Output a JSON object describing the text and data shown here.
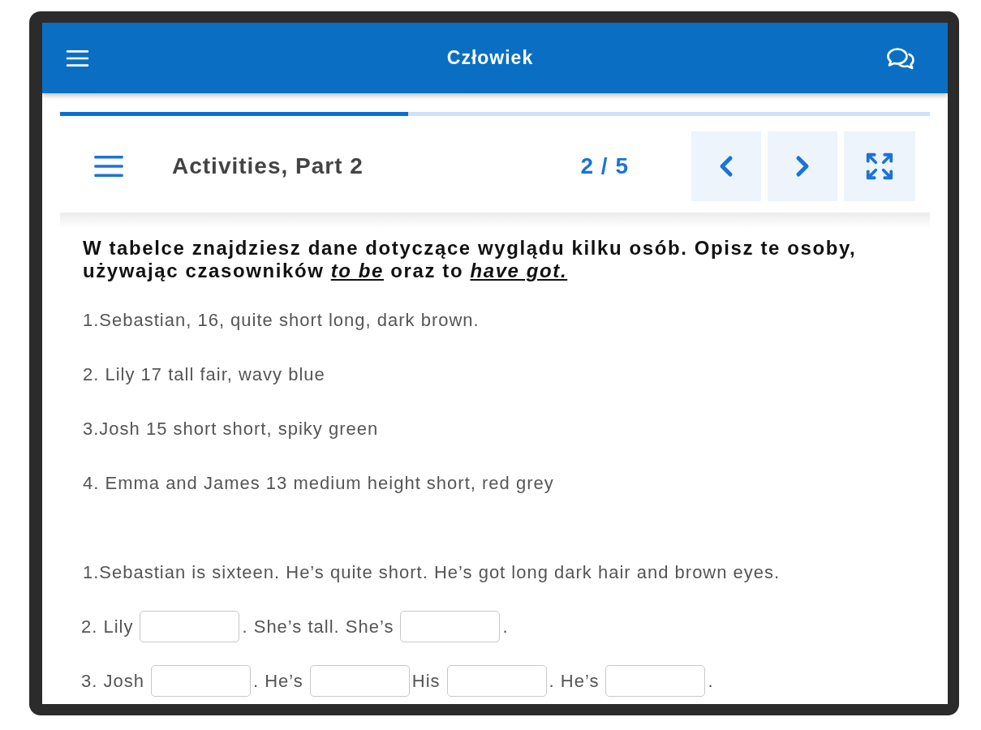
{
  "header": {
    "title": "Człowiek"
  },
  "progress": {
    "level": 0.4
  },
  "toolbar": {
    "title": "Activities, Part 2",
    "page": "2 / 5"
  },
  "task": {
    "instruction": "W tabelce znajdziesz dane dotyczące wyglądu kilku osób. Opisz te osoby, używając czasowników *to be* oraz to *have got.*",
    "data_lines": [
      "1.Sebastian, 16, quite short long, dark brown.",
      "2. Lily 17 tall fair, wavy blue",
      "3.Josh 15 short short, spiky green",
      "4. Emma and James 13 medium height short, red grey"
    ],
    "example": "1.Sebastian is sixteen. He’s quite short. He’s got long dark hair and brown eyes.",
    "rows": [
      {
        "parts": [
          {
            "kind": "text",
            "text": "2. Lily"
          },
          {
            "kind": "blank"
          },
          {
            "kind": "text",
            "text": ". She’s tall. She’s"
          },
          {
            "kind": "blank"
          },
          {
            "kind": "text",
            "text": "."
          }
        ]
      },
      {
        "parts": [
          {
            "kind": "text",
            "text": "3. Josh"
          },
          {
            "kind": "blank"
          },
          {
            "kind": "text",
            "text": ". He’s"
          },
          {
            "kind": "blank"
          },
          {
            "kind": "text",
            "text": "His"
          },
          {
            "kind": "blank"
          },
          {
            "kind": "text",
            "text": ". He’s"
          },
          {
            "kind": "blank"
          },
          {
            "kind": "text",
            "text": "."
          }
        ]
      }
    ]
  }
}
